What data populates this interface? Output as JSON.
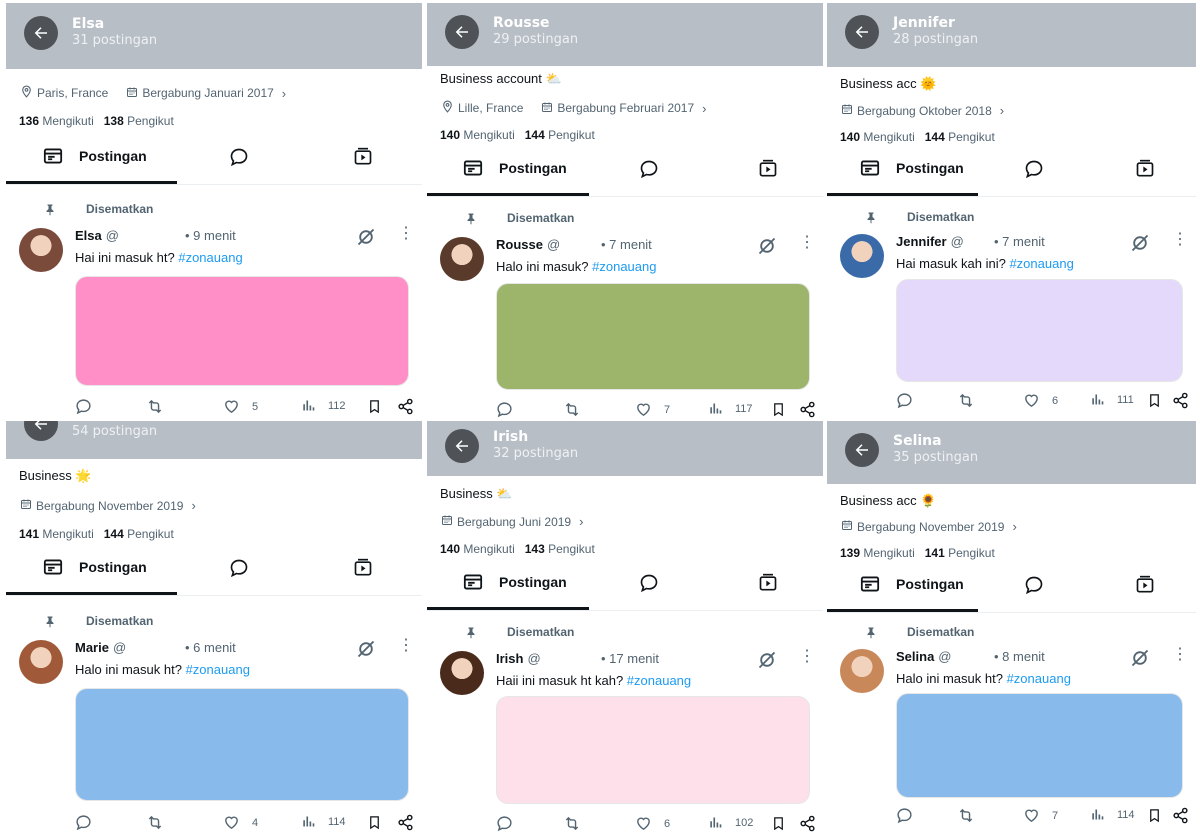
{
  "colors": {
    "header": "#b8bec6",
    "back_button": "#4f5256",
    "hashtag": "#1d9bf0"
  },
  "common": {
    "tab_posts": "Postingan",
    "pinned": "Disematkan",
    "following_label": "Mengikuti",
    "followers_label": "Pengikut",
    "at": "@"
  },
  "profiles": [
    {
      "name": "Elsa",
      "post_count": "31 postingan",
      "bio": "",
      "location": "Paris, France",
      "joined": "Bergabung Januari 2017",
      "following": "136",
      "followers": "138",
      "tweet": {
        "name": "Elsa",
        "time": "• 9 menit",
        "text": "Hai ini masuk ht?",
        "hashtag": "#zonauang",
        "media_color": "#ff8fc6",
        "likes": "5",
        "views": "112"
      }
    },
    {
      "name": "Rousse",
      "post_count": "29 postingan",
      "bio": "Business account ⛅",
      "location": "Lille, France",
      "joined": "Bergabung Februari 2017",
      "following": "140",
      "followers": "144",
      "tweet": {
        "name": "Rousse",
        "time": "• 7 menit",
        "text": "Halo ini masuk?",
        "hashtag": "#zonauang",
        "media_color": "#9db56a",
        "likes": "7",
        "views": "117"
      }
    },
    {
      "name": "Jennifer",
      "post_count": "28 postingan",
      "bio": "Business acc 🌞",
      "location": "",
      "joined": "Bergabung Oktober 2018",
      "following": "140",
      "followers": "144",
      "tweet": {
        "name": "Jennifer",
        "time": "• 7 menit",
        "text": "Hai masuk kah ini?",
        "hashtag": "#zonauang",
        "media_color": "#e5d9fb",
        "likes": "6",
        "views": "111"
      }
    },
    {
      "name": "",
      "post_count": "54 postingan",
      "bio": "Business 🌟",
      "location": "",
      "joined": "Bergabung November 2019",
      "following": "141",
      "followers": "144",
      "tweet": {
        "name": "Marie",
        "time": "• 6 menit",
        "text": "Halo ini masuk ht?",
        "hashtag": "#zonauang",
        "media_color": "#88bbec",
        "likes": "4",
        "views": "114"
      }
    },
    {
      "name": "Irish",
      "post_count": "32 postingan",
      "bio": "Business ⛅",
      "location": "",
      "joined": "Bergabung Juni 2019",
      "following": "140",
      "followers": "143",
      "tweet": {
        "name": "Irish",
        "time": "• 17 menit",
        "text": "Haii ini masuk ht kah?",
        "hashtag": "#zonauang",
        "media_color": "#fde0ea",
        "likes": "6",
        "views": "102"
      }
    },
    {
      "name": "Selina",
      "post_count": "35 postingan",
      "bio": "Business acc 🌻",
      "location": "",
      "joined": "Bergabung November 2019",
      "following": "139",
      "followers": "141",
      "tweet": {
        "name": "Selina",
        "time": "• 8 menit",
        "text": "Halo ini masuk ht?",
        "hashtag": "#zonauang",
        "media_color": "#88bbec",
        "likes": "7",
        "views": "114"
      }
    }
  ]
}
